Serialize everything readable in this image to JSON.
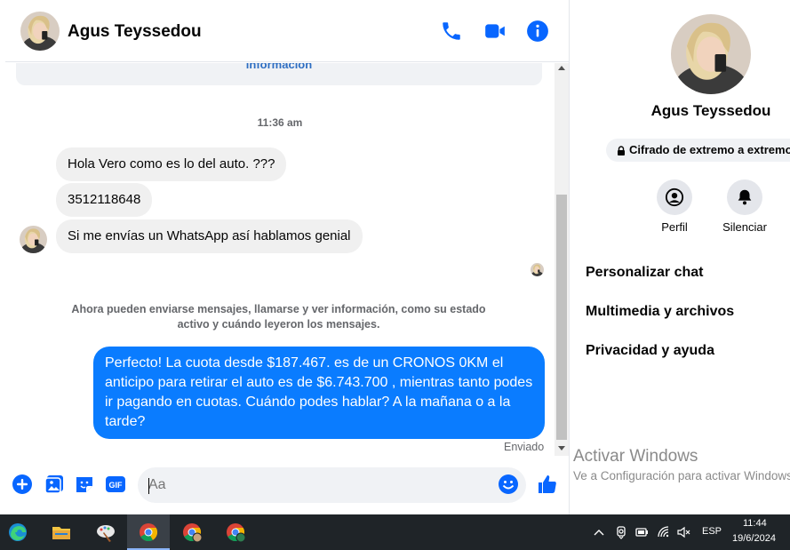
{
  "header": {
    "contact_name": "Agus Teyssedou",
    "call_icon": "phone-icon",
    "video_icon": "video-call-icon",
    "info_icon": "info-icon"
  },
  "messages": {
    "info_link": "información",
    "timestamp": "11:36 am",
    "incoming": [
      "Hola Vero como es lo del auto. ???",
      "3512118648",
      "Si me envías un WhatsApp así hablamos genial"
    ],
    "system_notice": "Ahora pueden enviarse mensajes, llamarse y ver información, como su estado activo y cuándo leyeron los mensajes.",
    "outgoing": "Perfecto! La cuota desde $187.467. es de un CRONOS 0KM el anticipo para retirar el auto es de $6.743.700 , mientras tanto podes ir pagando en cuotas. Cuándo podes hablar? A la mañana o a la tarde?",
    "status": "Enviado"
  },
  "composer": {
    "placeholder": "Aa",
    "icons": [
      "plus-icon",
      "photo-icon",
      "sticker-icon",
      "gif-icon",
      "emoji-icon",
      "like-icon"
    ],
    "gif_label": "GIF"
  },
  "profile": {
    "name": "Agus Teyssedou",
    "encryption_badge": "Cifrado de extremo a extremo",
    "actions": [
      {
        "label": "Perfil",
        "icon": "profile-icon"
      },
      {
        "label": "Silenciar",
        "icon": "bell-icon"
      }
    ],
    "menu": [
      "Personalizar chat",
      "Multimedia y archivos",
      "Privacidad y ayuda"
    ]
  },
  "watermark": {
    "title": "Activar Windows",
    "subtitle": "Ve a Configuración para activar Windows."
  },
  "taskbar": {
    "apps": [
      "edge-icon",
      "file-explorer-icon",
      "paint-icon",
      "chrome-icon",
      "chrome-profile-icon",
      "chrome-profile-t-icon"
    ],
    "language": "ESP",
    "time": "11:44",
    "date": "19/6/2024"
  },
  "colors": {
    "accent": "#0a7cff",
    "icon_blue": "#0866ff",
    "bubble_in": "#f0f0f0",
    "taskbar": "#1f2428"
  }
}
